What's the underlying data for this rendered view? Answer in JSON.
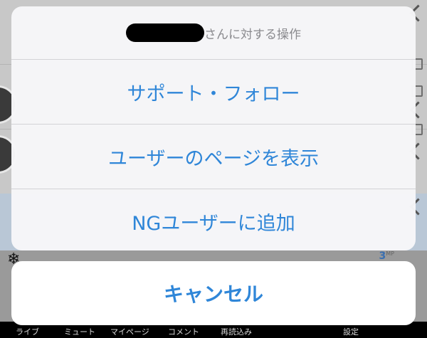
{
  "sheet": {
    "title_suffix": "さんに対する操作",
    "actions": [
      {
        "label": "サポート・フォロー"
      },
      {
        "label": "ユーザーのページを表示"
      },
      {
        "label": "NGユーザーに追加"
      }
    ],
    "cancel_label": "キャンセル"
  },
  "background": {
    "item_count": "3",
    "item_count_unit": "MP",
    "tabs": [
      "ライブ",
      "ミュート",
      "マイページ",
      "コメント",
      "再読込み",
      "設定"
    ]
  },
  "colors": {
    "accent": "#2f86d8",
    "sheet_bg": "#f6f6f8",
    "cancel_bg": "#ffffff"
  }
}
